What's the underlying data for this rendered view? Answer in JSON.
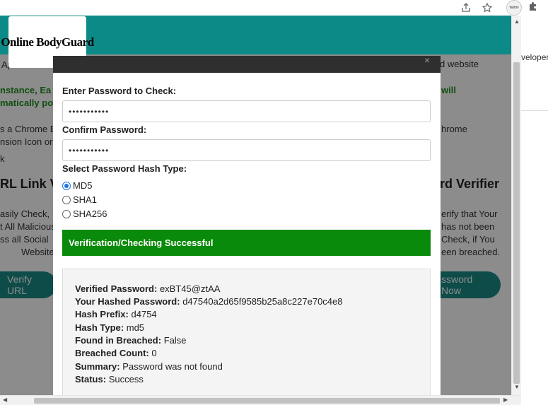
{
  "browser": {
    "extension_avatar_text": "faktini"
  },
  "header": {
    "logo_text": "Online BodyGuard"
  },
  "background": {
    "fragments": [
      {
        "text": "Ap"
      },
      {
        "text": "d website"
      },
      {
        "text": "nstance, Ea"
      },
      {
        "text": "will"
      },
      {
        "text": "matically po"
      },
      {
        "text": "s a Chrome E"
      },
      {
        "text": "hrome"
      },
      {
        "text": "nsion Icon or"
      },
      {
        "text": "k"
      },
      {
        "text": "asily Check,"
      },
      {
        "text": "erify that Your"
      },
      {
        "text": "t All Malicious"
      },
      {
        "text": "has not been"
      },
      {
        "text": "ss all Social"
      },
      {
        "text": "Check, if You"
      },
      {
        "text": "Website"
      },
      {
        "text": "een breached."
      }
    ],
    "headings": {
      "left": "RL Link V",
      "right": "rd Verifier"
    },
    "buttons": {
      "left": "Verify URL",
      "right": "ssword Now"
    },
    "side_text": "veloper"
  },
  "modal": {
    "close_symbol": "×",
    "password_label": "Enter Password to Check:",
    "password_value": "•••••••••••",
    "confirm_label": "Confirm Password:",
    "confirm_value": "•••••••••••",
    "hash_type_label": "Select Password Hash Type:",
    "hash_options": [
      {
        "label": "MD5",
        "checked": true
      },
      {
        "label": "SHA1",
        "checked": false
      },
      {
        "label": "SHA256",
        "checked": false
      }
    ],
    "status_message": "Verification/Checking Successful",
    "results": [
      {
        "key": "Verified Password:",
        "value": "exBT45@ztAA"
      },
      {
        "key": "Your Hashed Password:",
        "value": "d47540a2d65f9585b25a8c227e70c4e8"
      },
      {
        "key": "Hash Prefix:",
        "value": "d4754"
      },
      {
        "key": "Hash Type:",
        "value": "md5"
      },
      {
        "key": "Found in Breached:",
        "value": "False"
      },
      {
        "key": "Breached Count:",
        "value": "0"
      },
      {
        "key": "Summary:",
        "value": "Password was not found"
      },
      {
        "key": "Status:",
        "value": "Success"
      }
    ]
  },
  "colors": {
    "teal": "#0c8a87",
    "success_green": "#0a8a0a"
  }
}
